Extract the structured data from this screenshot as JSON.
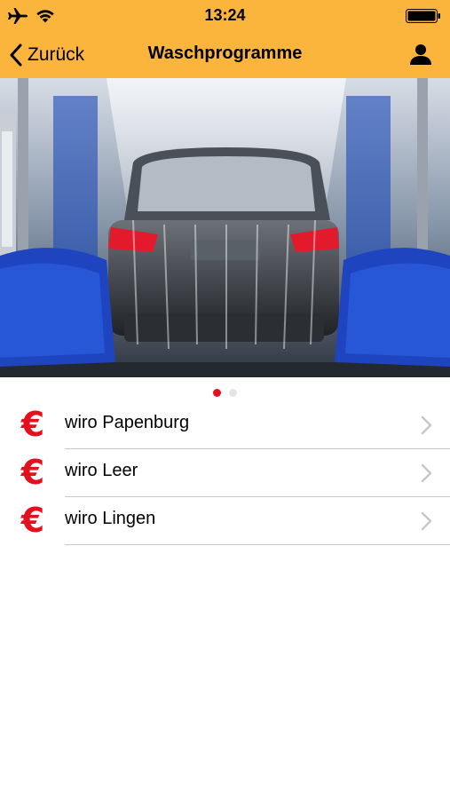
{
  "status_bar": {
    "time": "13:24"
  },
  "nav": {
    "back_label": "Zurück",
    "title": "Waschprogramme"
  },
  "carousel": {
    "page_count": 2,
    "active_index": 0
  },
  "locations": [
    {
      "label": "wiro Papenburg",
      "icon": "euro-icon"
    },
    {
      "label": "wiro Leer",
      "icon": "euro-icon"
    },
    {
      "label": "wiro Lingen",
      "icon": "euro-icon"
    }
  ],
  "colors": {
    "header": "#fbb53c",
    "accent": "#e3101e",
    "separator": "#c8c7cc"
  }
}
